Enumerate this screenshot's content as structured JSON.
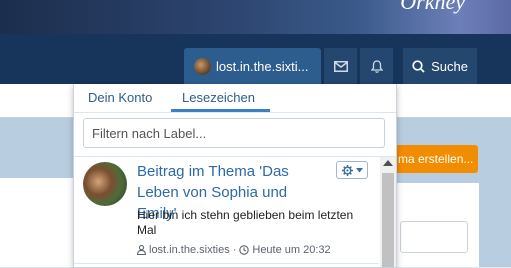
{
  "banner": {
    "title": "Orkney"
  },
  "navbar": {
    "user_name": "lost.in.the.sixti...",
    "search_label": "Suche"
  },
  "background": {
    "orange_button_label": "ma erstellen..."
  },
  "menu": {
    "tabs": [
      {
        "label": "Dein Konto"
      },
      {
        "label": "Lesezeichen"
      }
    ],
    "filter": {
      "placeholder": "Filtern nach Label...",
      "value": ""
    },
    "bookmarks": [
      {
        "title": "Beitrag im Thema 'Das Leben von Sophia und Emily'",
        "text": "Hier bin ich stehn geblieben beim letzten Mal",
        "author": "lost.in.the.sixties",
        "separator": "·",
        "time": "Heute um 20:32"
      }
    ]
  },
  "icons": {
    "mail": "envelope-icon",
    "bell": "bell-icon",
    "search": "search-icon",
    "gear": "gear-icon",
    "user": "user-icon",
    "clock": "clock-icon"
  },
  "colors": {
    "navbar": "#17345a",
    "nav_active": "#2d5d8f",
    "link": "#2d6aa7",
    "accent": "#f28c00",
    "tab_underline": "#3a80c4"
  }
}
